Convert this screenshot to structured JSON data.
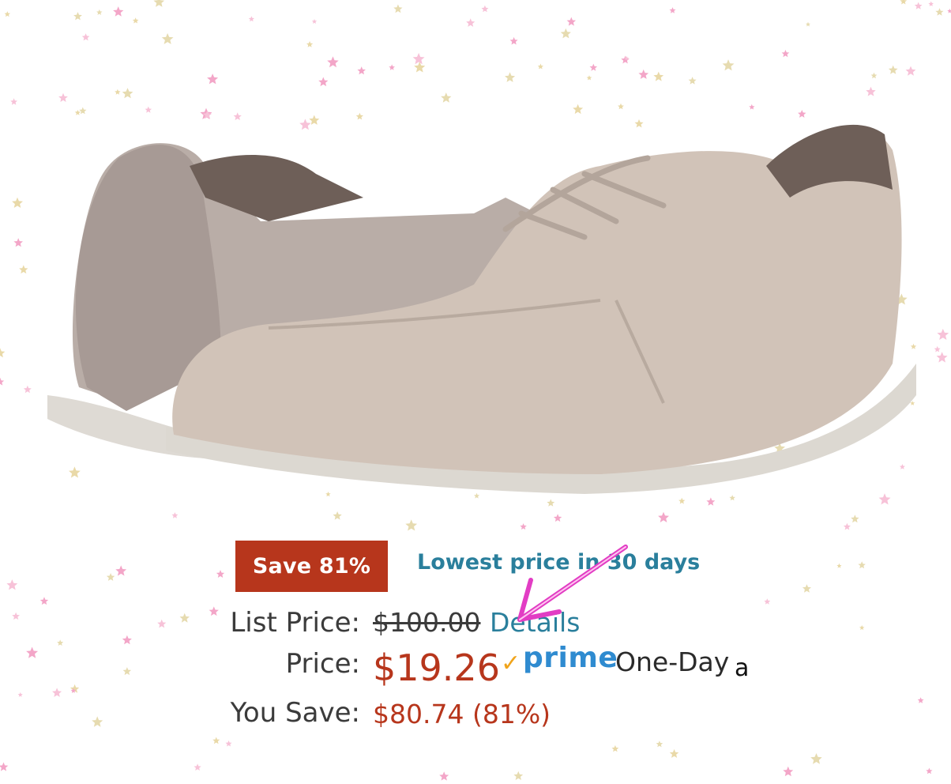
{
  "deal": {
    "badge": "Save 81%",
    "link": "Lowest price in 30 days",
    "badge_color": "#b7361c",
    "link_color": "#2a7f9c"
  },
  "pricing": {
    "list_label": "List Price:",
    "list_value": "$100.00",
    "details_link": "Details",
    "price_label": "Price:",
    "price_value": "$19.26",
    "prime_check": "✓",
    "prime_word": "prime",
    "prime_delivery": "One-Day",
    "trailing_glyph": "a",
    "save_label": "You Save:",
    "save_value": "$80.74 (81%)",
    "price_color": "#b7361c"
  },
  "annotation": {
    "icon": "arrow-icon",
    "color": "#e23dc4"
  },
  "product": {
    "icon": "shoe-image",
    "color": "#cfc2b8"
  }
}
